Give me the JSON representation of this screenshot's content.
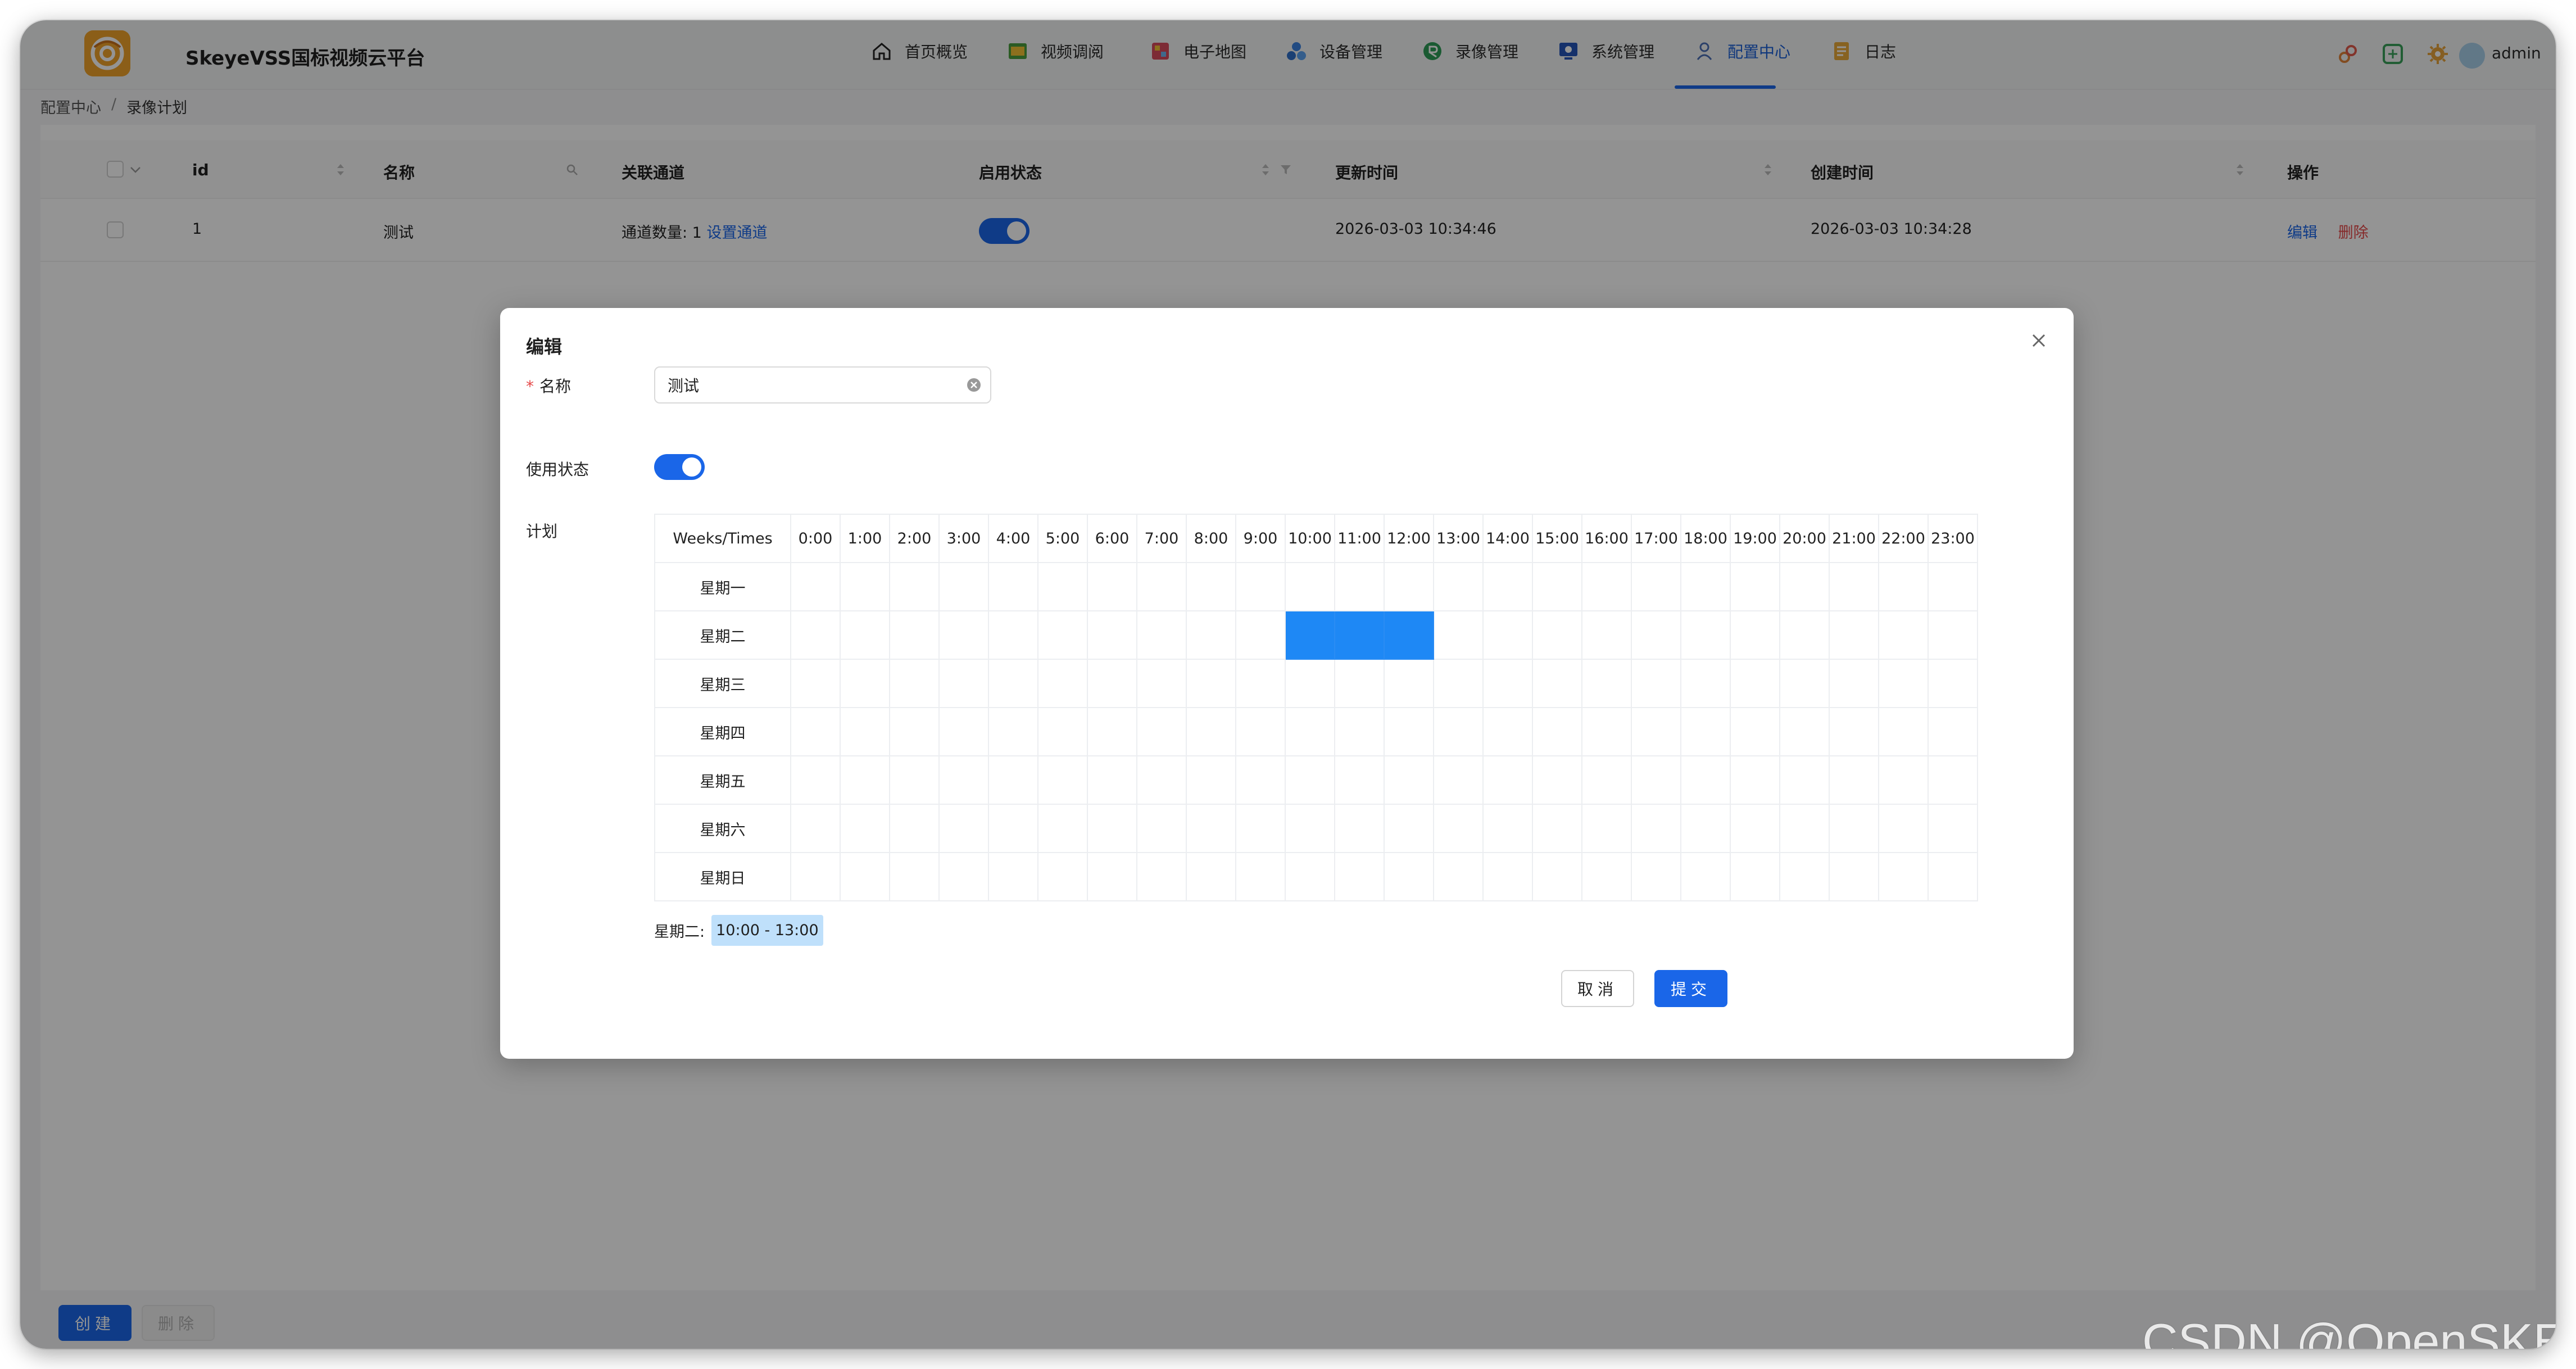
{
  "app": {
    "title": "SkeyeVSS国标视频云平台"
  },
  "nav": {
    "items": [
      {
        "label": "首页概览",
        "icon": "home-icon"
      },
      {
        "label": "视频调阅",
        "icon": "video-icon"
      },
      {
        "label": "电子地图",
        "icon": "map-icon"
      },
      {
        "label": "设备管理",
        "icon": "device-icon"
      },
      {
        "label": "录像管理",
        "icon": "record-icon"
      },
      {
        "label": "系统管理",
        "icon": "system-icon"
      },
      {
        "label": "配置中心",
        "icon": "config-icon",
        "active": true
      },
      {
        "label": "日志",
        "icon": "log-icon"
      }
    ]
  },
  "user": {
    "name": "admin"
  },
  "breadcrumb": {
    "root": "配置中心",
    "separator": "/",
    "current": "录像计划"
  },
  "table": {
    "headers": {
      "id": "id",
      "name": "名称",
      "channel": "关联通道",
      "status": "启用状态",
      "updated": "更新时间",
      "created": "创建时间",
      "actions": "操作"
    },
    "rows": [
      {
        "id": "1",
        "name": "测试",
        "channel_count": "通道数量: 1",
        "channel_link": "设置通道",
        "enabled": true,
        "updated": "2026-03-03 10:34:46",
        "created": "2026-03-03 10:34:28",
        "edit": "编辑",
        "delete": "删除"
      }
    ]
  },
  "bottom": {
    "create": "创建",
    "delete": "删除"
  },
  "modal": {
    "title": "编辑",
    "name_label": "名称",
    "name_value": "测试",
    "status_label": "使用状态",
    "status_on": true,
    "plan_label": "计划",
    "schedule": {
      "corner": "Weeks/Times",
      "hours": [
        "0:00",
        "1:00",
        "2:00",
        "3:00",
        "4:00",
        "5:00",
        "6:00",
        "7:00",
        "8:00",
        "9:00",
        "10:00",
        "11:00",
        "12:00",
        "13:00",
        "14:00",
        "15:00",
        "16:00",
        "17:00",
        "18:00",
        "19:00",
        "20:00",
        "21:00",
        "22:00",
        "23:00"
      ],
      "days": [
        "星期一",
        "星期二",
        "星期三",
        "星期四",
        "星期五",
        "星期六",
        "星期日"
      ],
      "selected": [
        {
          "day": 1,
          "hours": [
            10,
            11,
            12
          ]
        }
      ]
    },
    "summary_day": "星期二:",
    "summary_range": "10:00 - 13:00",
    "cancel": "取消",
    "submit": "提交"
  },
  "watermark": "CSDN @OpenSKEYE",
  "colors": {
    "primary": "#1a66e8",
    "selected_cell": "#1e88f5",
    "danger": "#e54848"
  }
}
